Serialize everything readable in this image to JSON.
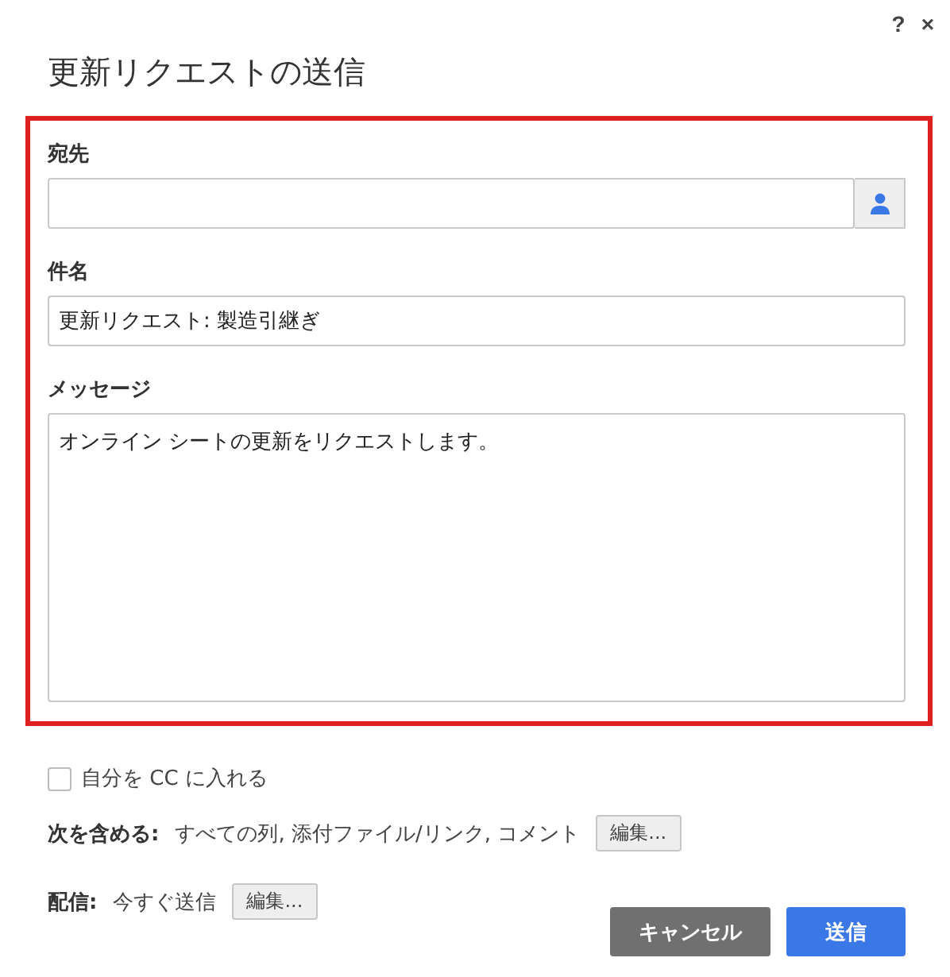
{
  "header_icons": [
    "?",
    "×"
  ],
  "title": "更新リクエストの送信",
  "to": {
    "label": "宛先"
  },
  "subject": {
    "label": "件名",
    "value": "更新リクエスト: 製造引継ぎ"
  },
  "message": {
    "label": "メッセージ",
    "value": "オンライン シートの更新をリクエストします。"
  },
  "cc_me": {
    "label": "自分を CC に入れる",
    "checked": false
  },
  "include": {
    "label": "次を含める:",
    "value": "すべての列, 添付ファイル/リンク, コメント",
    "button": "編集..."
  },
  "delivery": {
    "label": "配信:",
    "value": "今すぐ送信",
    "button": "編集..."
  },
  "buttons": [
    {
      "label": "キャンセル",
      "kind": "secondary"
    },
    {
      "label": "送信",
      "kind": "primary"
    }
  ]
}
